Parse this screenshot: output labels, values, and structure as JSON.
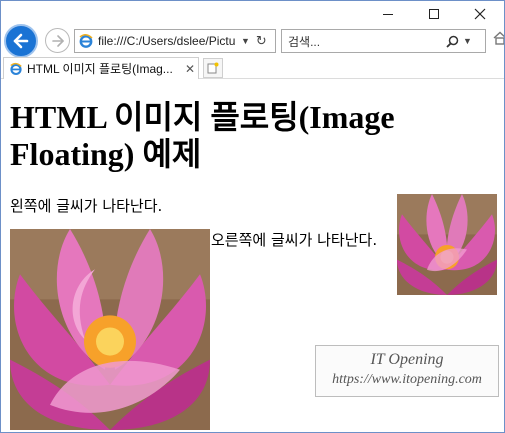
{
  "window": {
    "minimize_icon": "minimize-icon",
    "maximize_icon": "maximize-icon",
    "close_icon": "close-icon"
  },
  "nav": {
    "address": "file:///C:/Users/dslee/Pictu",
    "search_placeholder": "검색...",
    "accent_color": "#1a73d4"
  },
  "tab": {
    "title": "HTML 이미지 플로팅(Imag...",
    "close_glyph": "✕"
  },
  "page": {
    "heading": "HTML 이미지 플로팅(Image Floating) 예제",
    "left_text": "왼쪽에 글씨가 나타난다.",
    "right_text": "오른쪽에 글씨가 나타난다.",
    "image_alt": "pink lotus flower"
  },
  "watermark": {
    "title": "IT Opening",
    "url": "https://www.itopening.com"
  }
}
